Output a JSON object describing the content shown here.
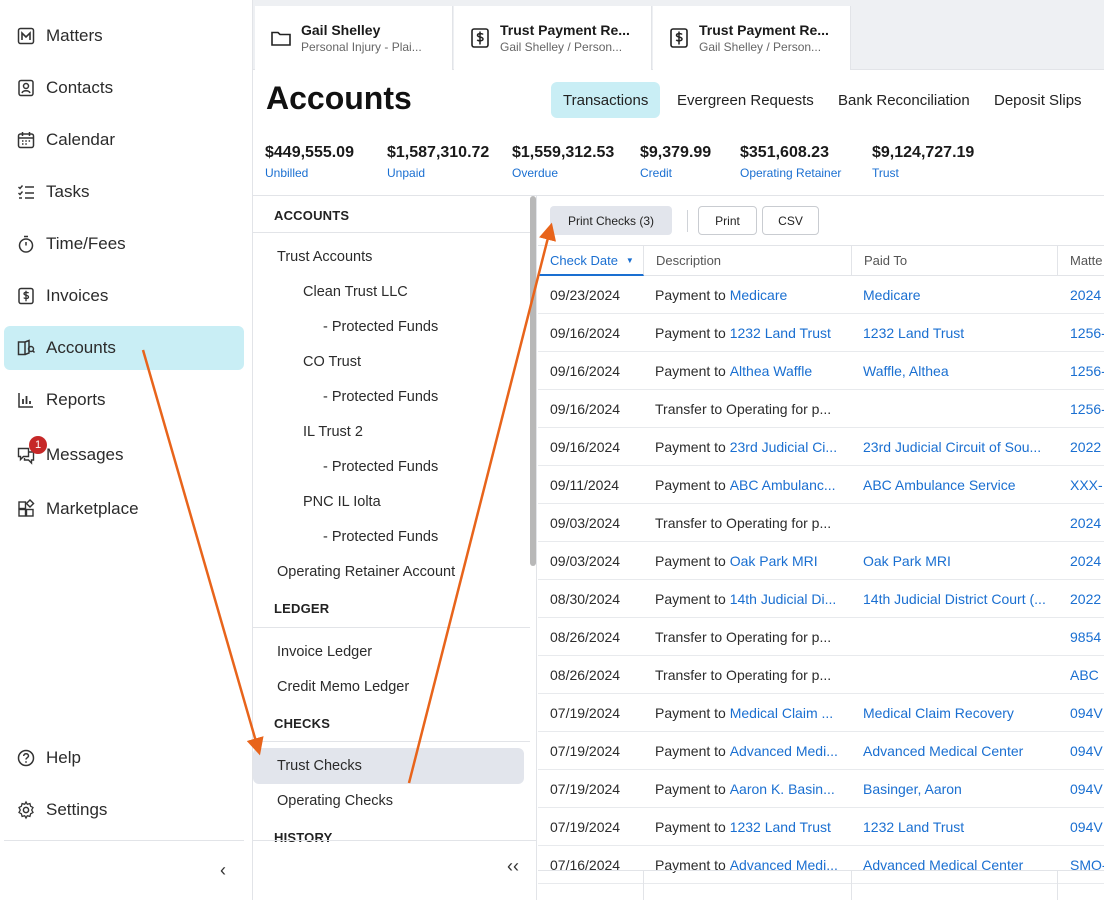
{
  "nav": {
    "items": [
      {
        "label": "Matters",
        "icon": "matters-icon"
      },
      {
        "label": "Contacts",
        "icon": "contacts-icon"
      },
      {
        "label": "Calendar",
        "icon": "calendar-icon"
      },
      {
        "label": "Tasks",
        "icon": "tasks-icon"
      },
      {
        "label": "Time/Fees",
        "icon": "stopwatch-icon"
      },
      {
        "label": "Invoices",
        "icon": "invoice-icon"
      },
      {
        "label": "Accounts",
        "icon": "accounts-icon",
        "active": true
      },
      {
        "label": "Reports",
        "icon": "reports-icon"
      },
      {
        "label": "Messages",
        "icon": "messages-icon",
        "badge": "1"
      },
      {
        "label": "Marketplace",
        "icon": "marketplace-icon"
      }
    ],
    "bottom": [
      {
        "label": "Help",
        "icon": "help-icon"
      },
      {
        "label": "Settings",
        "icon": "settings-icon"
      }
    ],
    "collapse_glyph": "‹"
  },
  "open_tabs": [
    {
      "title": "Gail Shelley",
      "subtitle": "Personal Injury - Plai...",
      "icon": "folder-icon"
    },
    {
      "title": "Trust Payment Re...",
      "subtitle": "Gail Shelley / Person...",
      "icon": "dollar-document-icon"
    },
    {
      "title": "Trust Payment Re...",
      "subtitle": "Gail Shelley / Person...",
      "icon": "dollar-document-icon"
    }
  ],
  "page": {
    "title": "Accounts",
    "subtabs": [
      "Transactions",
      "Evergreen Requests",
      "Bank Reconciliation",
      "Deposit Slips"
    ],
    "active_subtab": "Transactions"
  },
  "summary": [
    {
      "amount": "$449,555.09",
      "label": "Unbilled"
    },
    {
      "amount": "$1,587,310.72",
      "label": "Unpaid"
    },
    {
      "amount": "$1,559,312.53",
      "label": "Overdue"
    },
    {
      "amount": "$9,379.99",
      "label": "Credit"
    },
    {
      "amount": "$351,608.23",
      "label": "Operating Retainer"
    },
    {
      "amount": "$9,124,727.19",
      "label": "Trust"
    }
  ],
  "panel": {
    "accounts_heading": "ACCOUNTS",
    "trust_accounts": "Trust Accounts",
    "accounts": [
      {
        "name": "Clean Trust LLC",
        "sub": "- Protected Funds"
      },
      {
        "name": "CO Trust",
        "sub": "- Protected Funds"
      },
      {
        "name": "IL Trust 2",
        "sub": "- Protected Funds"
      },
      {
        "name": "PNC IL Iolta",
        "sub": "- Protected Funds"
      }
    ],
    "operating_retainer": "Operating Retainer Account",
    "ledger_heading": "LEDGER",
    "invoice_ledger": "Invoice Ledger",
    "credit_memo_ledger": "Credit Memo Ledger",
    "checks_heading": "CHECKS",
    "trust_checks": "Trust Checks",
    "operating_checks": "Operating Checks",
    "history_heading": "HISTORY",
    "collapse_glyph": "‹‹"
  },
  "toolbar": {
    "print_checks": "Print Checks (3)",
    "print": "Print",
    "csv": "CSV"
  },
  "grid": {
    "headers": [
      "Check Date",
      "Description",
      "Paid To",
      "Matte"
    ],
    "sorted_column": "Check Date",
    "rows": [
      {
        "date": "09/23/2024",
        "desc_prefix": "Payment to ",
        "desc_link": "Medicare",
        "paid_to": "Medicare",
        "matter": "2024"
      },
      {
        "date": "09/16/2024",
        "desc_prefix": "Payment to ",
        "desc_link": "1232 Land Trust",
        "paid_to": "1232 Land Trust",
        "matter": "1256-"
      },
      {
        "date": "09/16/2024",
        "desc_prefix": "Payment to ",
        "desc_link": "Althea Waffle",
        "paid_to": "Waffle, Althea",
        "matter": "1256-"
      },
      {
        "date": "09/16/2024",
        "desc_prefix": "Transfer to Operating for p...",
        "desc_link": "",
        "paid_to": "",
        "matter": "1256-"
      },
      {
        "date": "09/16/2024",
        "desc_prefix": "Payment to ",
        "desc_link": "23rd Judicial Ci...",
        "paid_to": "23rd Judicial Circuit of Sou...",
        "matter": "2022"
      },
      {
        "date": "09/11/2024",
        "desc_prefix": "Payment to ",
        "desc_link": "ABC Ambulanc...",
        "paid_to": "ABC Ambulance Service",
        "matter": "XXX-"
      },
      {
        "date": "09/03/2024",
        "desc_prefix": "Transfer to Operating for p...",
        "desc_link": "",
        "paid_to": "",
        "matter": "2024"
      },
      {
        "date": "09/03/2024",
        "desc_prefix": "Payment to ",
        "desc_link": "Oak Park MRI",
        "paid_to": "Oak Park MRI",
        "matter": "2024"
      },
      {
        "date": "08/30/2024",
        "desc_prefix": "Payment to ",
        "desc_link": "14th Judicial Di...",
        "paid_to": "14th Judicial District Court (...",
        "matter": "2022"
      },
      {
        "date": "08/26/2024",
        "desc_prefix": "Transfer to Operating for p...",
        "desc_link": "",
        "paid_to": "",
        "matter": "9854"
      },
      {
        "date": "08/26/2024",
        "desc_prefix": "Transfer to Operating for p...",
        "desc_link": "",
        "paid_to": "",
        "matter": "ABC"
      },
      {
        "date": "07/19/2024",
        "desc_prefix": "Payment to ",
        "desc_link": "Medical Claim ...",
        "paid_to": "Medical Claim Recovery",
        "matter": "094V"
      },
      {
        "date": "07/19/2024",
        "desc_prefix": "Payment to ",
        "desc_link": "Advanced Medi...",
        "paid_to": "Advanced Medical Center",
        "matter": "094V"
      },
      {
        "date": "07/19/2024",
        "desc_prefix": "Payment to ",
        "desc_link": "Aaron K. Basin...",
        "paid_to": "Basinger, Aaron",
        "matter": "094V"
      },
      {
        "date": "07/19/2024",
        "desc_prefix": "Payment to ",
        "desc_link": "1232 Land Trust",
        "paid_to": "1232 Land Trust",
        "matter": "094V"
      },
      {
        "date": "07/16/2024",
        "desc_prefix": "Payment to ",
        "desc_link": "Advanced Medi...",
        "paid_to": "Advanced Medical Center",
        "matter": "SMO-"
      }
    ]
  },
  "colors": {
    "accent_bg": "#c9eef5",
    "link": "#1a6fd1",
    "arrow": "#e8641b",
    "badge": "#c62828"
  }
}
